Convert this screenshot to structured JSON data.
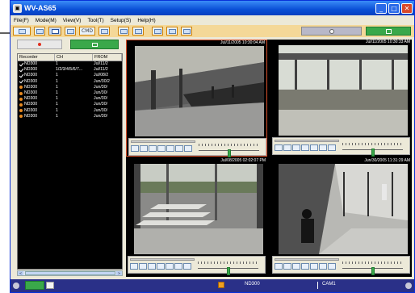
{
  "window": {
    "title": "WV-AS65",
    "icon": "camera-app-icon",
    "controls": [
      "minimize-icon",
      "maximize-icon",
      "close-icon"
    ],
    "controls_text": [
      "_",
      "□",
      "✕"
    ]
  },
  "menu": [
    {
      "label": "File(F)"
    },
    {
      "label": "Mode(M)"
    },
    {
      "label": "View(V)"
    },
    {
      "label": "Tool(T)"
    },
    {
      "label": "Setup(S)"
    },
    {
      "label": "Help(H)"
    }
  ],
  "toolbar": {
    "cmd_label": "CMD",
    "green_icon": "window-icon",
    "grey_icon": "record-icon"
  },
  "recorder_list": {
    "columns": [
      "Recorder",
      "CH",
      "FROM"
    ],
    "rows": [
      {
        "status": "check",
        "recorder": "ND300",
        "ch": "1",
        "from": "Jul/11/2"
      },
      {
        "status": "check",
        "recorder": "ND300",
        "ch": "1/2/3/4/5/6/7...",
        "from": "Jul/11/2"
      },
      {
        "status": "check",
        "recorder": "ND300",
        "ch": "1",
        "from": "Jul/08/2"
      },
      {
        "status": "check",
        "recorder": "ND300",
        "ch": "1",
        "from": "Jun/30/2"
      },
      {
        "status": "dot",
        "recorder": "ND300",
        "ch": "1",
        "from": "Jun/30/"
      },
      {
        "status": "dot",
        "recorder": "ND300",
        "ch": "1",
        "from": "Jun/30/"
      },
      {
        "status": "dot",
        "recorder": "ND300",
        "ch": "1",
        "from": "Jun/30/"
      },
      {
        "status": "dot",
        "recorder": "ND300",
        "ch": "1",
        "from": "Jun/30/"
      },
      {
        "status": "dot",
        "recorder": "ND300",
        "ch": "1",
        "from": "Jun/30/"
      },
      {
        "status": "dot",
        "recorder": "ND300",
        "ch": "1",
        "from": "Jun/30/"
      }
    ],
    "scroll_left": "<",
    "scroll_right": ">"
  },
  "cameras": [
    {
      "timestamp": "Jul/11/2005 10:30:04 AM",
      "selected": true,
      "scene": "station-platform"
    },
    {
      "timestamp": "Jul/11/2005 10:30:33 AM",
      "selected": false,
      "scene": "glass-corridor"
    },
    {
      "timestamp": "Jul/08/2005 02:02:07 PM",
      "selected": false,
      "scene": "entrance-crosswalk"
    },
    {
      "timestamp": "Jun/30/2005 11:31:29 AM",
      "selected": false,
      "scene": "lobby-door"
    }
  ],
  "status": {
    "device": "ND300",
    "camera": "CAM1"
  }
}
